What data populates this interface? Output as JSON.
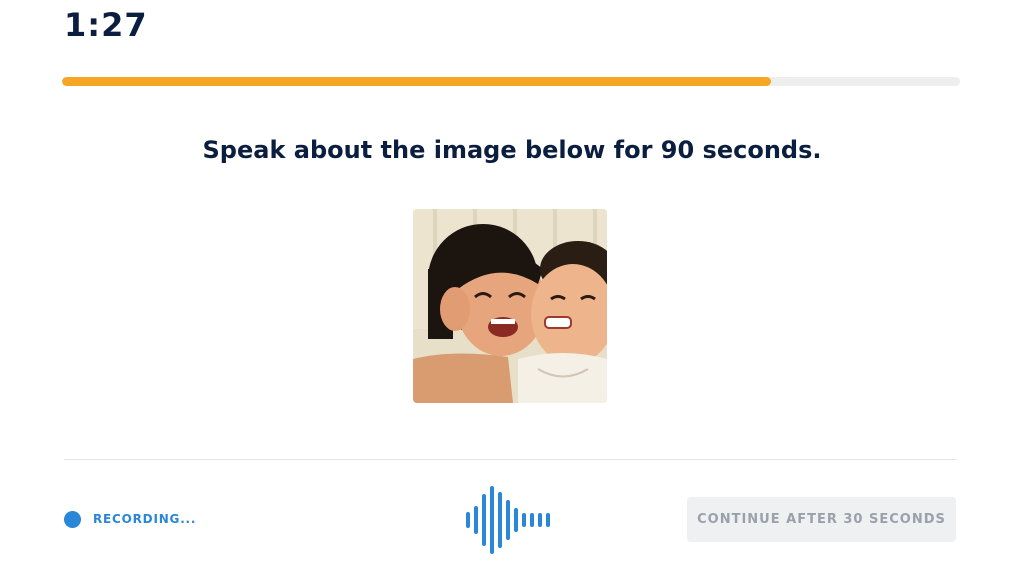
{
  "timer": {
    "text": "1:27"
  },
  "progress": {
    "fraction": 0.79,
    "color": "#f5a623",
    "track_color": "#eeeeee"
  },
  "prompt": {
    "text": "Speak about the image below for 90 seconds."
  },
  "recording": {
    "label": "RECORDING...",
    "dot_color": "#2a86d6",
    "waveform_icon": "audio-waveform-icon"
  },
  "continue_button": {
    "label": "CONTINUE AFTER 30 SECONDS",
    "disabled": true
  },
  "colors": {
    "heading": "#0b1e3f",
    "accent": "#2a86d6"
  }
}
